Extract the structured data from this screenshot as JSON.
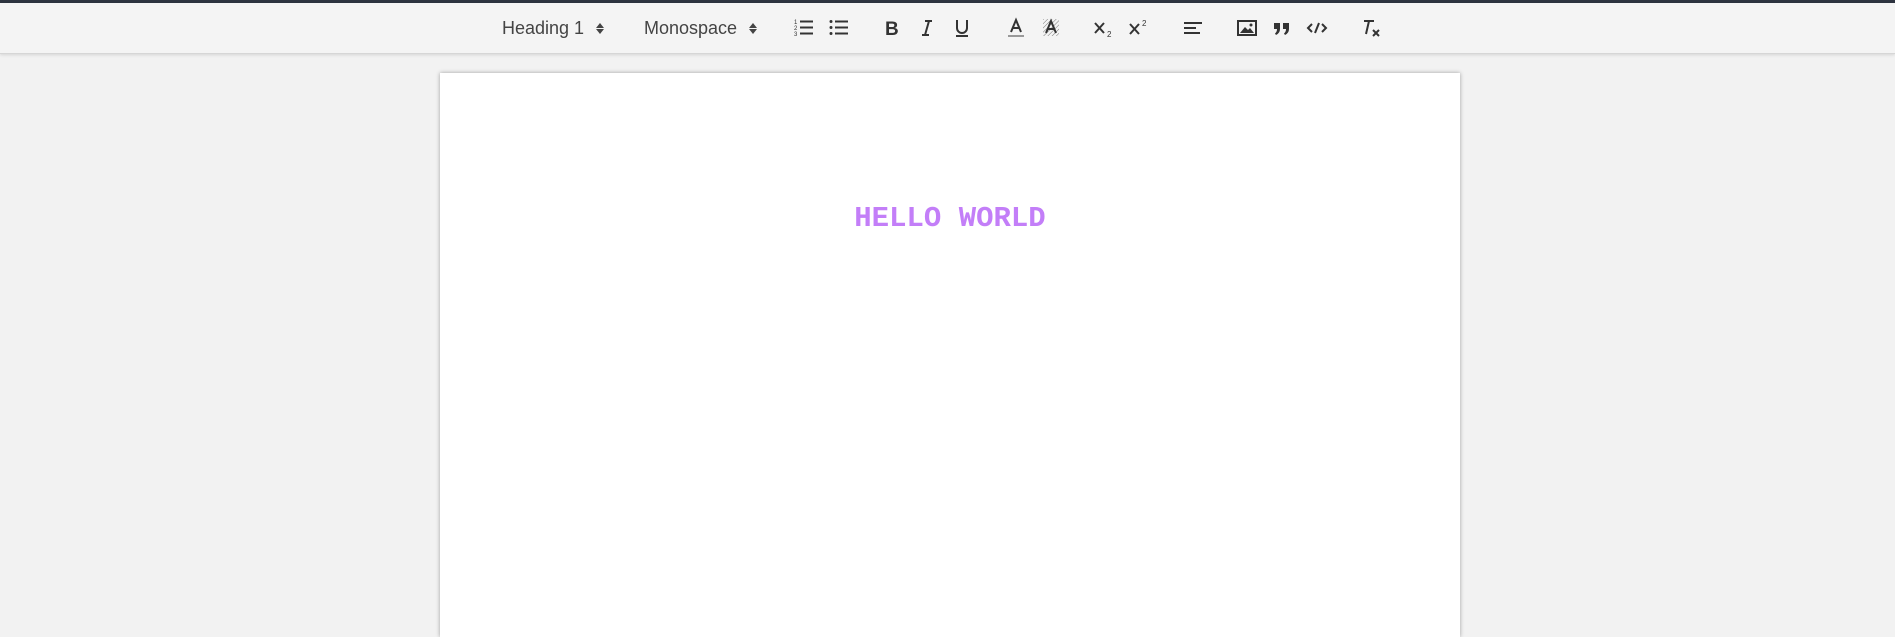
{
  "toolbar": {
    "heading_select": {
      "value": "Heading 1"
    },
    "font_select": {
      "value": "Monospace"
    },
    "buttons": [
      {
        "name": "ordered-list",
        "icon": "ordered-list-icon"
      },
      {
        "name": "bullet-list",
        "icon": "bullet-list-icon"
      },
      {
        "name": "bold",
        "icon": "bold-icon",
        "glyph": "B"
      },
      {
        "name": "italic",
        "icon": "italic-icon",
        "glyph": "I"
      },
      {
        "name": "underline",
        "icon": "underline-icon",
        "glyph": "U"
      },
      {
        "name": "text-color",
        "icon": "text-color-icon",
        "glyph": "A"
      },
      {
        "name": "highlight",
        "icon": "highlight-icon",
        "glyph": "A"
      },
      {
        "name": "subscript",
        "icon": "subscript-icon",
        "glyph": "x",
        "sub": "2"
      },
      {
        "name": "superscript",
        "icon": "superscript-icon",
        "glyph": "x",
        "sup": "2"
      },
      {
        "name": "align",
        "icon": "align-left-icon"
      },
      {
        "name": "image",
        "icon": "image-icon"
      },
      {
        "name": "blockquote",
        "icon": "quote-icon"
      },
      {
        "name": "code",
        "icon": "code-icon"
      },
      {
        "name": "clear-format",
        "icon": "clear-format-icon",
        "glyph": "T"
      }
    ]
  },
  "document": {
    "heading_text": "HELLO WORLD",
    "heading_color": "#c37ef8"
  },
  "colors": {
    "background": "#f2f2f2",
    "toolbar": "#f4f4f4",
    "icon": "#333333",
    "page": "#ffffff"
  }
}
